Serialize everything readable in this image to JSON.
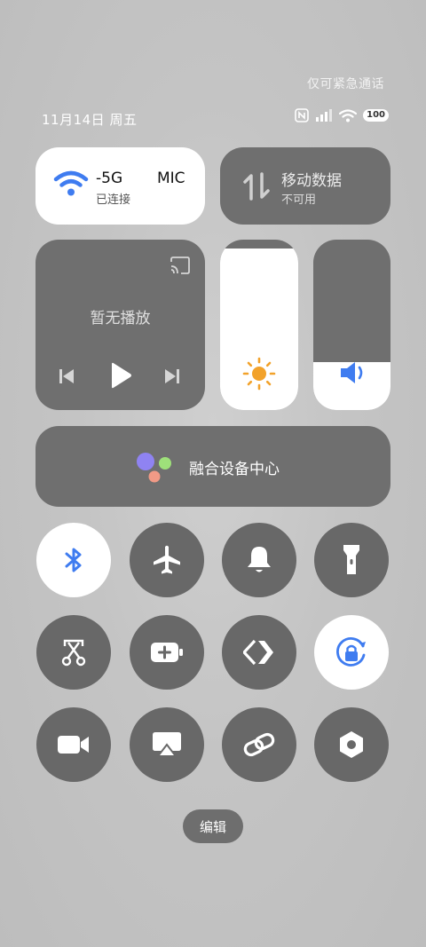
{
  "header": {
    "emergency_text": "仅可紧急通话",
    "date": "11月14日 周五",
    "battery": "100"
  },
  "wifi_tile": {
    "title": "-5G",
    "title_cut": "MIC",
    "subtitle": "已连接"
  },
  "mobile_tile": {
    "title": "移动数据",
    "subtitle": "不可用"
  },
  "media_tile": {
    "text": "暂无播放"
  },
  "brightness": {
    "level": 0.95
  },
  "volume": {
    "level": 0.28
  },
  "center_tile": {
    "label": "融合设备中心"
  },
  "toggles": [
    {
      "name": "bluetooth",
      "on": true
    },
    {
      "name": "airplane",
      "on": false
    },
    {
      "name": "ring",
      "on": false
    },
    {
      "name": "flashlight",
      "on": false
    },
    {
      "name": "screenshot",
      "on": false
    },
    {
      "name": "battery-saver",
      "on": false
    },
    {
      "name": "nearby-share",
      "on": false
    },
    {
      "name": "rotation-lock",
      "on": true
    },
    {
      "name": "screen-record",
      "on": false
    },
    {
      "name": "screen-cast",
      "on": false
    },
    {
      "name": "link",
      "on": false
    },
    {
      "name": "settings",
      "on": false
    }
  ],
  "colors": {
    "accent": "#3f7cf0",
    "sun": "#f2a22b",
    "tile": "#6f6f6f"
  },
  "edit_label": "编辑"
}
